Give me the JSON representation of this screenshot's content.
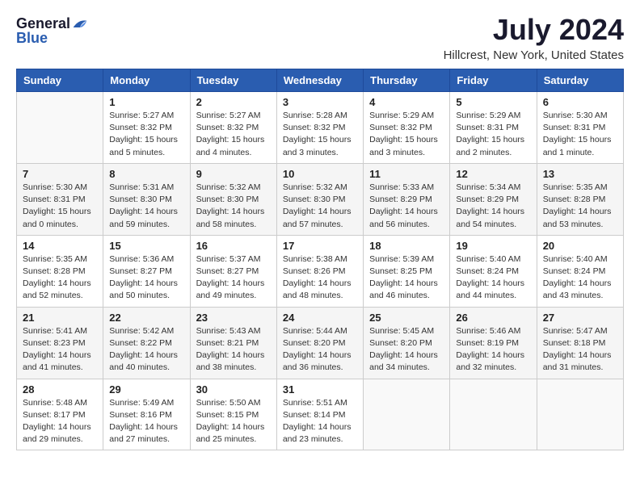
{
  "header": {
    "logo_general": "General",
    "logo_blue": "Blue",
    "title": "July 2024",
    "subtitle": "Hillcrest, New York, United States"
  },
  "calendar": {
    "days_of_week": [
      "Sunday",
      "Monday",
      "Tuesday",
      "Wednesday",
      "Thursday",
      "Friday",
      "Saturday"
    ],
    "weeks": [
      [
        {
          "day": "",
          "info": ""
        },
        {
          "day": "1",
          "info": "Sunrise: 5:27 AM\nSunset: 8:32 PM\nDaylight: 15 hours\nand 5 minutes."
        },
        {
          "day": "2",
          "info": "Sunrise: 5:27 AM\nSunset: 8:32 PM\nDaylight: 15 hours\nand 4 minutes."
        },
        {
          "day": "3",
          "info": "Sunrise: 5:28 AM\nSunset: 8:32 PM\nDaylight: 15 hours\nand 3 minutes."
        },
        {
          "day": "4",
          "info": "Sunrise: 5:29 AM\nSunset: 8:32 PM\nDaylight: 15 hours\nand 3 minutes."
        },
        {
          "day": "5",
          "info": "Sunrise: 5:29 AM\nSunset: 8:31 PM\nDaylight: 15 hours\nand 2 minutes."
        },
        {
          "day": "6",
          "info": "Sunrise: 5:30 AM\nSunset: 8:31 PM\nDaylight: 15 hours\nand 1 minute."
        }
      ],
      [
        {
          "day": "7",
          "info": "Sunrise: 5:30 AM\nSunset: 8:31 PM\nDaylight: 15 hours\nand 0 minutes."
        },
        {
          "day": "8",
          "info": "Sunrise: 5:31 AM\nSunset: 8:30 PM\nDaylight: 14 hours\nand 59 minutes."
        },
        {
          "day": "9",
          "info": "Sunrise: 5:32 AM\nSunset: 8:30 PM\nDaylight: 14 hours\nand 58 minutes."
        },
        {
          "day": "10",
          "info": "Sunrise: 5:32 AM\nSunset: 8:30 PM\nDaylight: 14 hours\nand 57 minutes."
        },
        {
          "day": "11",
          "info": "Sunrise: 5:33 AM\nSunset: 8:29 PM\nDaylight: 14 hours\nand 56 minutes."
        },
        {
          "day": "12",
          "info": "Sunrise: 5:34 AM\nSunset: 8:29 PM\nDaylight: 14 hours\nand 54 minutes."
        },
        {
          "day": "13",
          "info": "Sunrise: 5:35 AM\nSunset: 8:28 PM\nDaylight: 14 hours\nand 53 minutes."
        }
      ],
      [
        {
          "day": "14",
          "info": "Sunrise: 5:35 AM\nSunset: 8:28 PM\nDaylight: 14 hours\nand 52 minutes."
        },
        {
          "day": "15",
          "info": "Sunrise: 5:36 AM\nSunset: 8:27 PM\nDaylight: 14 hours\nand 50 minutes."
        },
        {
          "day": "16",
          "info": "Sunrise: 5:37 AM\nSunset: 8:27 PM\nDaylight: 14 hours\nand 49 minutes."
        },
        {
          "day": "17",
          "info": "Sunrise: 5:38 AM\nSunset: 8:26 PM\nDaylight: 14 hours\nand 48 minutes."
        },
        {
          "day": "18",
          "info": "Sunrise: 5:39 AM\nSunset: 8:25 PM\nDaylight: 14 hours\nand 46 minutes."
        },
        {
          "day": "19",
          "info": "Sunrise: 5:40 AM\nSunset: 8:24 PM\nDaylight: 14 hours\nand 44 minutes."
        },
        {
          "day": "20",
          "info": "Sunrise: 5:40 AM\nSunset: 8:24 PM\nDaylight: 14 hours\nand 43 minutes."
        }
      ],
      [
        {
          "day": "21",
          "info": "Sunrise: 5:41 AM\nSunset: 8:23 PM\nDaylight: 14 hours\nand 41 minutes."
        },
        {
          "day": "22",
          "info": "Sunrise: 5:42 AM\nSunset: 8:22 PM\nDaylight: 14 hours\nand 40 minutes."
        },
        {
          "day": "23",
          "info": "Sunrise: 5:43 AM\nSunset: 8:21 PM\nDaylight: 14 hours\nand 38 minutes."
        },
        {
          "day": "24",
          "info": "Sunrise: 5:44 AM\nSunset: 8:20 PM\nDaylight: 14 hours\nand 36 minutes."
        },
        {
          "day": "25",
          "info": "Sunrise: 5:45 AM\nSunset: 8:20 PM\nDaylight: 14 hours\nand 34 minutes."
        },
        {
          "day": "26",
          "info": "Sunrise: 5:46 AM\nSunset: 8:19 PM\nDaylight: 14 hours\nand 32 minutes."
        },
        {
          "day": "27",
          "info": "Sunrise: 5:47 AM\nSunset: 8:18 PM\nDaylight: 14 hours\nand 31 minutes."
        }
      ],
      [
        {
          "day": "28",
          "info": "Sunrise: 5:48 AM\nSunset: 8:17 PM\nDaylight: 14 hours\nand 29 minutes."
        },
        {
          "day": "29",
          "info": "Sunrise: 5:49 AM\nSunset: 8:16 PM\nDaylight: 14 hours\nand 27 minutes."
        },
        {
          "day": "30",
          "info": "Sunrise: 5:50 AM\nSunset: 8:15 PM\nDaylight: 14 hours\nand 25 minutes."
        },
        {
          "day": "31",
          "info": "Sunrise: 5:51 AM\nSunset: 8:14 PM\nDaylight: 14 hours\nand 23 minutes."
        },
        {
          "day": "",
          "info": ""
        },
        {
          "day": "",
          "info": ""
        },
        {
          "day": "",
          "info": ""
        }
      ]
    ]
  }
}
